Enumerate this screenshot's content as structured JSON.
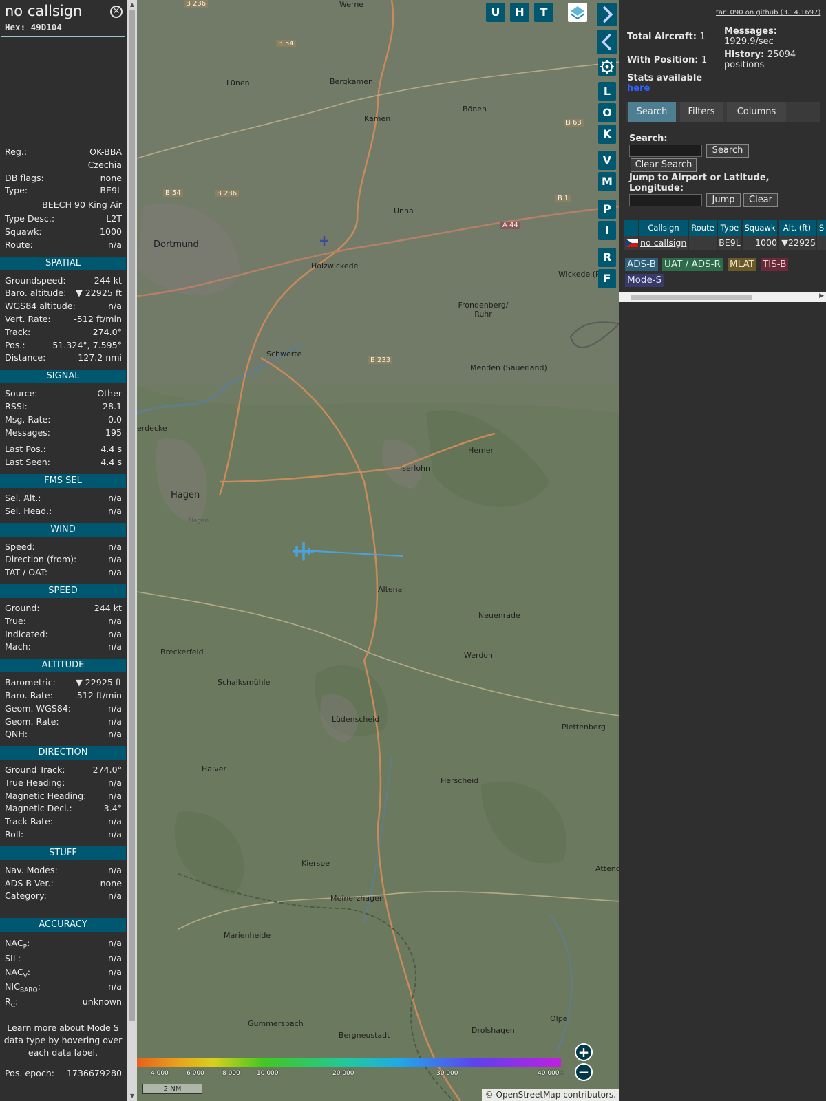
{
  "info": {
    "callsign": "no callsign",
    "hex_label": "Hex:",
    "hex": "49D104",
    "close_icon": "close-icon",
    "reg_label": "Reg.:",
    "reg": "OK-BBA",
    "country": "Czechia",
    "dbflags_label": "DB flags:",
    "dbflags": "none",
    "type_label": "Type:",
    "type": "BE9L",
    "type_name": "BEECH 90 King Air",
    "typedesc_label": "Type Desc.:",
    "typedesc": "L2T",
    "squawk_label": "Squawk:",
    "squawk": "1000",
    "route_label": "Route:",
    "route": "n/a",
    "spatial": {
      "title": "SPATIAL",
      "rows": [
        {
          "label": "Groundspeed:",
          "value": "244 kt"
        },
        {
          "label": "Baro. altitude:",
          "value": "▼ 22925 ft"
        },
        {
          "label": "WGS84 altitude:",
          "value": "n/a"
        },
        {
          "label": "Vert. Rate:",
          "value": "-512 ft/min"
        },
        {
          "label": "Track:",
          "value": "274.0°"
        },
        {
          "label": "Pos.:",
          "value": "51.324°, 7.595°"
        },
        {
          "label": "Distance:",
          "value": "127.2 nmi"
        }
      ]
    },
    "signal": {
      "title": "SIGNAL",
      "rows": [
        {
          "label": "Source:",
          "value": "Other"
        },
        {
          "label": "RSSI:",
          "value": "-28.1"
        },
        {
          "label": "Msg. Rate:",
          "value": "0.0"
        },
        {
          "label": "Messages:",
          "value": "195"
        }
      ],
      "rows2": [
        {
          "label": "Last Pos.:",
          "value": "4.4 s"
        },
        {
          "label": "Last Seen:",
          "value": "4.4 s"
        }
      ]
    },
    "fms": {
      "title": "FMS SEL",
      "rows": [
        {
          "label": "Sel. Alt.:",
          "value": "n/a"
        },
        {
          "label": "Sel. Head.:",
          "value": "n/a"
        }
      ]
    },
    "wind": {
      "title": "WIND",
      "rows": [
        {
          "label": "Speed:",
          "value": "n/a"
        },
        {
          "label": "Direction (from):",
          "value": "n/a"
        },
        {
          "label": "TAT / OAT:",
          "value": "n/a"
        }
      ]
    },
    "speed": {
      "title": "SPEED",
      "rows": [
        {
          "label": "Ground:",
          "value": "244 kt"
        },
        {
          "label": "True:",
          "value": "n/a"
        },
        {
          "label": "Indicated:",
          "value": "n/a"
        },
        {
          "label": "Mach:",
          "value": "n/a"
        }
      ]
    },
    "altitude": {
      "title": "ALTITUDE",
      "rows": [
        {
          "label": "Barometric:",
          "value": "▼ 22925 ft"
        },
        {
          "label": "Baro. Rate:",
          "value": "-512 ft/min"
        },
        {
          "label": "Geom. WGS84:",
          "value": "n/a"
        },
        {
          "label": "Geom. Rate:",
          "value": "n/a"
        },
        {
          "label": "QNH:",
          "value": "n/a"
        }
      ]
    },
    "direction": {
      "title": "DIRECTION",
      "rows": [
        {
          "label": "Ground Track:",
          "value": "274.0°"
        },
        {
          "label": "True Heading:",
          "value": "n/a"
        },
        {
          "label": "Magnetic Heading:",
          "value": "n/a"
        },
        {
          "label": "Magnetic Decl.:",
          "value": "3.4°"
        },
        {
          "label": "Track Rate:",
          "value": "n/a"
        },
        {
          "label": "Roll:",
          "value": "n/a"
        }
      ]
    },
    "stuff": {
      "title": "STUFF",
      "rows": [
        {
          "label": "Nav. Modes:",
          "value": "n/a"
        },
        {
          "label": "ADS-B Ver.:",
          "value": "none"
        },
        {
          "label": "Category:",
          "value": "n/a"
        }
      ]
    },
    "accuracy": {
      "title": "ACCURACY",
      "nacp_label": "NAC",
      "nacp_sub": "P",
      "nacp": "n/a",
      "sil_label": "SIL:",
      "sil": "n/a",
      "nacv_label": "NAC",
      "nacv_sub": "V",
      "nacv": "n/a",
      "nic_label": "NIC",
      "nic_sub": "BARO",
      "nic": "n/a",
      "rc_label": "R",
      "rc_sub": "C",
      "rc": "unknown"
    },
    "learn_more": "Learn more about Mode S data type by hovering over each data label.",
    "epoch_label": "Pos. epoch:",
    "epoch": "1736679280"
  },
  "map": {
    "buttons": [
      "U",
      "H",
      "T"
    ],
    "side_buttons": [
      "L",
      "O",
      "K",
      "V",
      "M",
      "P",
      "I",
      "R",
      "F"
    ],
    "layers_icon": "layers-icon",
    "settings_icon": "gear-icon",
    "altitude_ticks": [
      "4 000",
      "6 000",
      "8 000",
      "10 000",
      "20 000",
      "30 000",
      "40 000+"
    ],
    "scale": "2 NM",
    "attribution": "© OpenStreetMap contributors.",
    "attribution_link": "OpenStreetMap",
    "places": [
      "Werne",
      "Lünen",
      "Bergkamen",
      "Kamen",
      "Bönen",
      "Dortmund",
      "Unna",
      "Holzwickede",
      "Frondenberg/ Ruhr",
      "Wickede (R",
      "Schwerte",
      "Menden (Sauerland)",
      "Hemer",
      "Iserlohn",
      "Hagen",
      "Altena",
      "Neuenrade",
      "Breckerfeld",
      "Werdohl",
      "Schalksmühle",
      "Lüdenscheid",
      "Plettenberg",
      "Halver",
      "Herscheid",
      "Kierspe",
      "Meinerzhagen",
      "Attend",
      "Marienheide",
      "Gummersbach",
      "Bergneustadt",
      "Drolshagen",
      "Olpe",
      "erdecke",
      "Hagen"
    ],
    "roads": [
      "B 236",
      "B 54",
      "B 63",
      "B 54",
      "B 236",
      "B 1",
      "A 44",
      "B 233"
    ],
    "colors": {
      "button": "#005870",
      "track": "#4aa3df",
      "plane": "#4aa3df"
    }
  },
  "right": {
    "github": "tar1090 on github (3.14.1697)",
    "total_label": "Total Aircraft:",
    "total": "1",
    "messages_label": "Messages:",
    "messages": "1929.9/sec",
    "withpos_label": "With Position:",
    "withpos": "1",
    "history_label": "History:",
    "history": "25094 positions",
    "stats_label": "Stats available",
    "stats_link": "here",
    "tabs": [
      "Search",
      "Filters",
      "Columns"
    ],
    "search_label": "Search:",
    "search_btn": "Search",
    "clear_search_btn": "Clear Search",
    "jump_label": "Jump to Airport or Latitude, Longitude:",
    "jump_btn": "Jump",
    "clear_btn": "Clear",
    "columns": [
      "",
      "Callsign",
      "Route",
      "Type",
      "Squawk",
      "Alt. (ft)",
      "S"
    ],
    "row": {
      "flag": "cz-flag-icon",
      "callsign": "no callsign",
      "route": "",
      "type": "BE9L",
      "squawk": "1000",
      "alt": "▼22925",
      "s": ""
    },
    "sources": [
      {
        "label": "ADS-B",
        "bg": "#2f5e78",
        "fg": "#d8eef8"
      },
      {
        "label": "UAT / ADS-R",
        "bg": "#2f6a4a",
        "fg": "#d8f4e0"
      },
      {
        "label": "MLAT",
        "bg": "#6a5a2a",
        "fg": "#f4e8c8"
      },
      {
        "label": "TIS-B",
        "bg": "#6a2a3a",
        "fg": "#f8d8e0"
      },
      {
        "label": "Mode-S",
        "bg": "#3a3a6a",
        "fg": "#e0e0f8"
      }
    ]
  }
}
